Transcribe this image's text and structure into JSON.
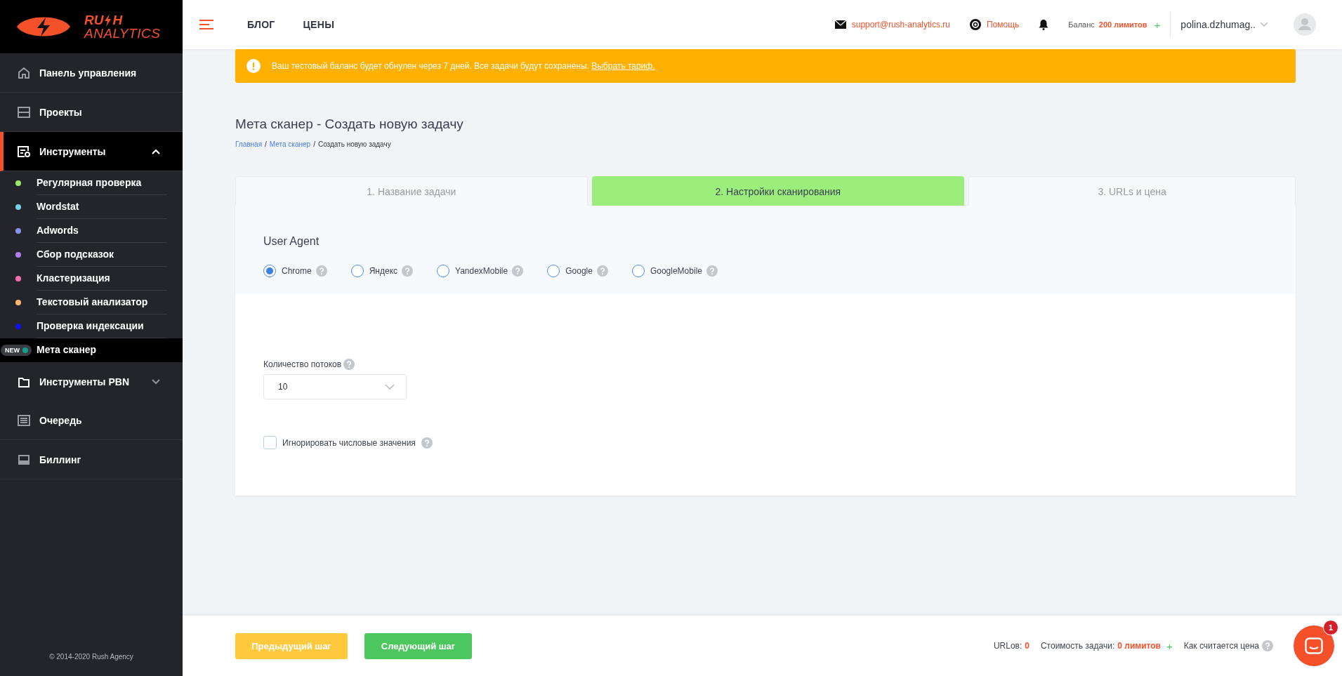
{
  "sidebar": {
    "logo": {
      "part1": "RU",
      "part2": "H",
      "line2": "ANALYTICS"
    },
    "items": [
      {
        "kind": "main",
        "label": "Панель управления",
        "selected": false
      },
      {
        "kind": "main",
        "label": "Проекты",
        "selected": false
      },
      {
        "kind": "main",
        "label": "Инструменты",
        "selected": true,
        "expanded": true,
        "children": [
          {
            "label": "Регулярная проверка",
            "color": "#9be86d",
            "selected": false
          },
          {
            "label": "Wordstat",
            "color": "#73d2e8",
            "selected": false
          },
          {
            "label": "Adwords",
            "color": "#8793e8",
            "selected": false
          },
          {
            "label": "Сбор подсказок",
            "color": "#b27de8",
            "selected": false
          },
          {
            "label": "Кластеризация",
            "color": "#f26fae",
            "selected": false
          },
          {
            "label": "Текстовый анализатор",
            "color": "#ffb86b",
            "selected": false
          },
          {
            "label": "Проверка индексации",
            "color": "#1010f0",
            "selected": false
          },
          {
            "label": "Мета сканер",
            "color": "#129e8c",
            "selected": true,
            "badge": "NEW"
          }
        ]
      },
      {
        "kind": "main",
        "label": "Инструменты PBN",
        "selected": false,
        "expanded": false
      },
      {
        "kind": "main",
        "label": "Очередь",
        "selected": false
      },
      {
        "kind": "main",
        "label": "Биллинг",
        "selected": false
      }
    ],
    "copyright": "© 2014-2020 Rush Agency"
  },
  "header": {
    "nav_links": [
      "БЛОГ",
      "ЦЕНЫ"
    ],
    "support_email": "support@rush-analytics.ru",
    "help": "Помощь",
    "balance_label": "Баланс",
    "balance_value": "200 лимитов",
    "balance_add": "+",
    "user": "polina.dzhumag.."
  },
  "alert": {
    "text": "Ваш тестовый баланс будет обнулен через 7 дней. Все задачи будут сохранены.",
    "link": "Выбрать тариф."
  },
  "page_title": "Мета сканер - Создать новую задачу",
  "breadcrumbs": {
    "separator": "/",
    "items": [
      {
        "label": "Главная",
        "link": true
      },
      {
        "label": "Мета сканер",
        "link": true
      },
      {
        "label": "Создать новую задачу",
        "link": false
      }
    ]
  },
  "steps": [
    {
      "label": "1. Название задачи",
      "selected": false
    },
    {
      "label": "2. Настройки сканирования",
      "selected": true
    },
    {
      "label": "3. URLs и цена",
      "selected": false
    }
  ],
  "user_agent": {
    "title": "User Agent",
    "options": [
      {
        "label": "Chrome",
        "selected": true
      },
      {
        "label": "Яндекс",
        "selected": false
      },
      {
        "label": "YandexMobile",
        "selected": false
      },
      {
        "label": "Google",
        "selected": false
      },
      {
        "label": "GoogleMobile",
        "selected": false
      }
    ]
  },
  "threads": {
    "label": "Количество потоков",
    "value": "10"
  },
  "ignore_numbers": {
    "label": "Игнорировать числовые значения",
    "checked": false
  },
  "footer": {
    "prev_button": "Предыдущий шаг",
    "next_button": "Следующий шаг",
    "urls_label": "URLов:",
    "urls_value": "0",
    "cost_label": "Стоимость задачи:",
    "cost_value": "0 лимитов",
    "cost_add": "+",
    "price_help": "Как считается цена",
    "chat_badge": "1"
  }
}
